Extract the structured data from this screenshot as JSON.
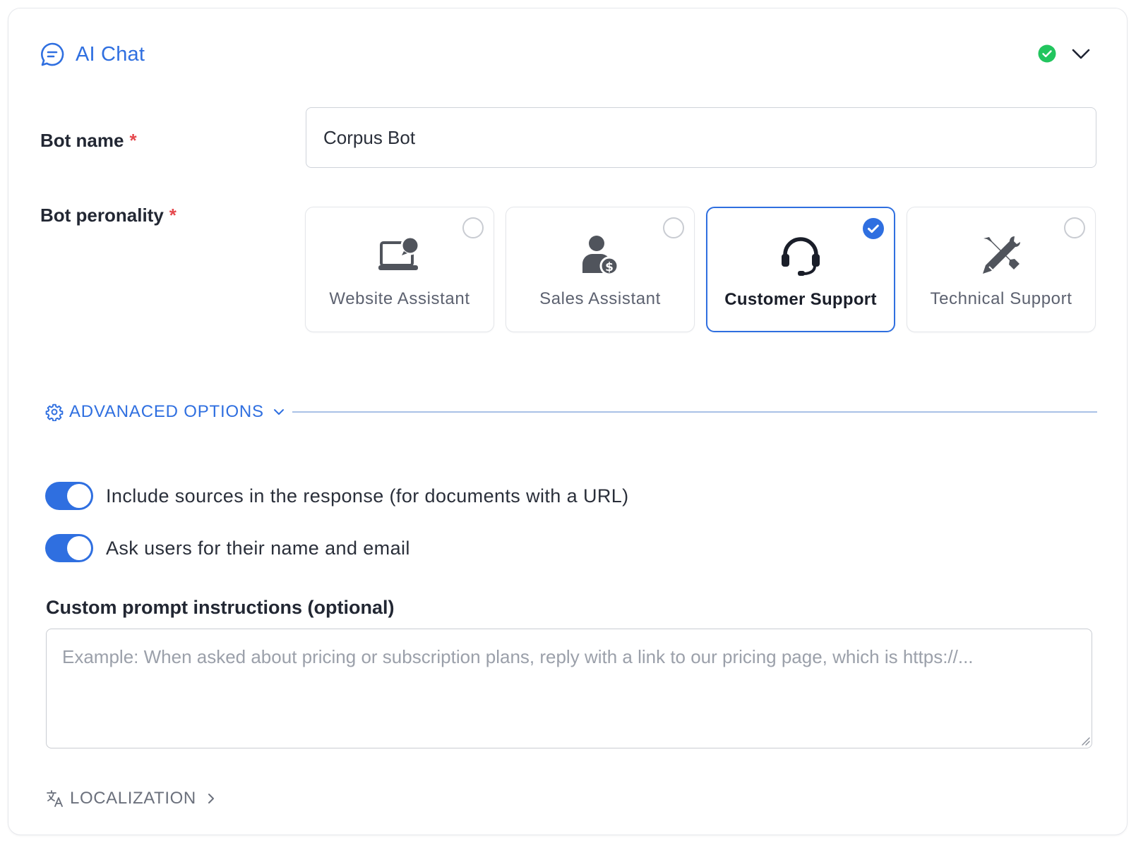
{
  "header": {
    "title": "AI Chat",
    "icon": "chat-bubble-icon",
    "status": "complete",
    "status_color": "#22c55e",
    "accent_color": "#2f6fe0"
  },
  "bot_name": {
    "label": "Bot name",
    "required_mark": "*",
    "value": "Corpus Bot"
  },
  "personality": {
    "label": "Bot peronality",
    "required_mark": "*",
    "options": [
      {
        "label": "Website Assistant",
        "icon": "laptop-chat-icon",
        "selected": false
      },
      {
        "label": "Sales Assistant",
        "icon": "person-dollar-icon",
        "selected": false
      },
      {
        "label": "Customer Support",
        "icon": "headset-icon",
        "selected": true
      },
      {
        "label": "Technical Support",
        "icon": "tools-icon",
        "selected": false
      }
    ]
  },
  "advanced": {
    "label": "ADVANACED OPTIONS",
    "icon": "gear-icon",
    "expanded": true,
    "toggles": [
      {
        "label": "Include sources in the response (for documents with a URL)",
        "on": true
      },
      {
        "label": "Ask users for their name and email",
        "on": true
      }
    ]
  },
  "custom_prompt": {
    "label": "Custom prompt instructions (optional)",
    "placeholder": "Example: When asked about pricing or subscription plans, reply with a link to our pricing page, which is https://...",
    "value": ""
  },
  "localization": {
    "label": "LOCALIZATION",
    "icon": "translate-icon",
    "expanded": false
  }
}
